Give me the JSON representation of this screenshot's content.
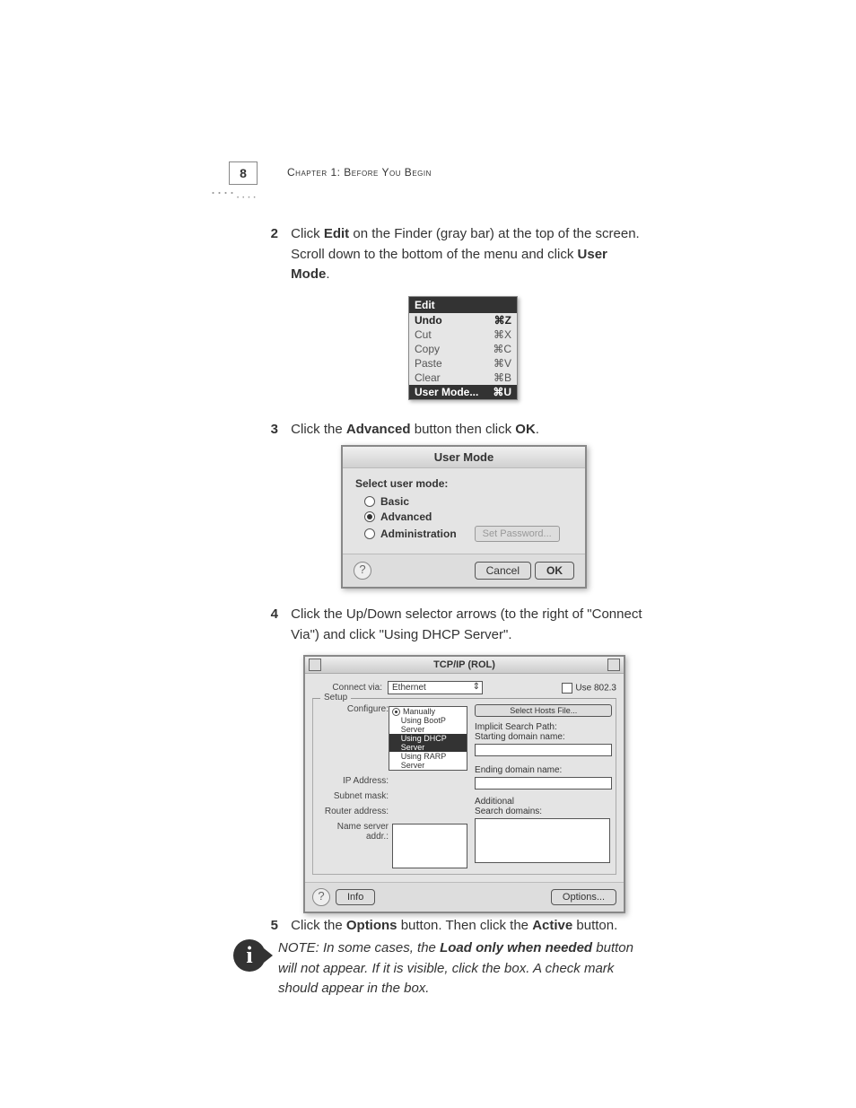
{
  "page_number": "8",
  "chapter_title": "Chapter 1: Before You Begin",
  "steps": {
    "s2": {
      "num": "2",
      "pre": "Click ",
      "b1": "Edit",
      "mid1": " on the Finder (gray bar) at the top of the screen. Scroll down to the bottom of the menu and click ",
      "b2": "User Mode",
      "post": "."
    },
    "s3": {
      "num": "3",
      "pre": "Click the ",
      "b1": "Advanced",
      "mid1": " button then click ",
      "b2": "OK",
      "post": "."
    },
    "s4": {
      "num": "4",
      "text": "Click the Up/Down selector arrows (to the right of \"Connect Via\") and click \"Using DHCP Server\"."
    },
    "s5": {
      "num": "5",
      "pre": "Click the ",
      "b1": "Options",
      "mid1": " button. Then click the ",
      "b2": "Active",
      "post": " button."
    }
  },
  "note": {
    "pre": "NOTE: In some cases, the ",
    "b1": "Load only when needed",
    "post": " button will not appear. If it is visible, click the box. A check mark should appear in the box."
  },
  "edit_menu": {
    "title": "Edit",
    "items": [
      {
        "label": "Undo",
        "sc": "⌘Z",
        "active": true
      },
      {
        "label": "Cut",
        "sc": "⌘X",
        "active": false
      },
      {
        "label": "Copy",
        "sc": "⌘C",
        "active": false
      },
      {
        "label": "Paste",
        "sc": "⌘V",
        "active": false
      },
      {
        "label": "Clear",
        "sc": "⌘B",
        "active": false
      }
    ],
    "highlight": {
      "label": "User Mode...",
      "sc": "⌘U"
    }
  },
  "user_mode_dialog": {
    "title": "User Mode",
    "select_label": "Select user mode:",
    "basic": "Basic",
    "advanced": "Advanced",
    "administration": "Administration",
    "set_password": "Set Password...",
    "cancel": "Cancel",
    "ok": "OK"
  },
  "tcpip": {
    "title": "TCP/IP (ROL)",
    "connect_via_label": "Connect via:",
    "connect_via_value": "Ethernet",
    "use_8023": "Use 802.3",
    "setup_label": "Setup",
    "configure_label": "Configure:",
    "configure_options": {
      "o1": "Manually",
      "o2": "Using BootP Server",
      "o3": "Using DHCP Server",
      "o4": "Using RARP Server"
    },
    "select_hosts": "Select Hosts File...",
    "implicit_search": "Implicit Search Path:",
    "starting_domain": "Starting domain name:",
    "ip_address": "IP Address:",
    "subnet_mask": "Subnet mask:",
    "router_address": "Router address:",
    "ending_domain": "Ending domain name:",
    "additional": "Additional",
    "search_domains": "Search domains:",
    "name_server": "Name server addr.:",
    "info": "Info",
    "options": "Options..."
  }
}
